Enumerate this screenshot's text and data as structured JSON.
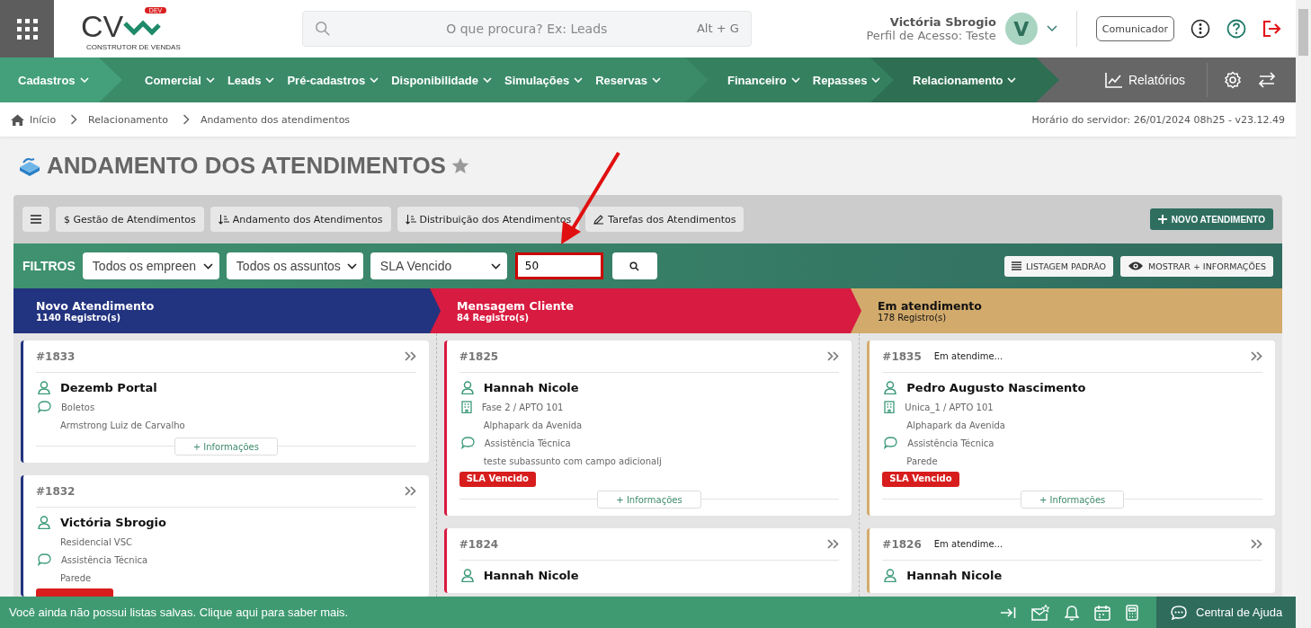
{
  "header": {
    "logo": {
      "mark": "CV",
      "tag": "DEV",
      "subtitle": "CONSTRUTOR DE VENDAS"
    },
    "search": {
      "placeholder": "O que procura? Ex: Leads",
      "shortcut": "Alt + G"
    },
    "user": {
      "name": "Victória Sbrogio",
      "profile": "Perfil de Acesso: Teste",
      "initial": "V"
    },
    "communicator": "Comunicador"
  },
  "nav": {
    "groups": [
      {
        "items": [
          "Cadastros"
        ]
      },
      {
        "items": [
          "Comercial",
          "Leads",
          "Pré-cadastros",
          "Disponibilidade",
          "Simulações",
          "Reservas"
        ]
      },
      {
        "items": [
          "Financeiro",
          "Repasses"
        ]
      },
      {
        "items": [
          "Relacionamento"
        ]
      }
    ],
    "reports": "Relatórios"
  },
  "breadcrumb": {
    "items": [
      "Início",
      "Relacionamento",
      "Andamento dos atendimentos"
    ],
    "server_time": "Horário do servidor: 26/01/2024 08h25 - v23.12.49"
  },
  "page_title": "ANDAMENTO DOS ATENDIMENTOS",
  "toolbar": {
    "tabs": [
      {
        "kind": "plain",
        "label": "$ Gestão de Atendimentos"
      },
      {
        "kind": "sort",
        "label": "Andamento dos Atendimentos"
      },
      {
        "kind": "sort",
        "label": "Distribuição dos Atendimentos"
      },
      {
        "kind": "edit",
        "label": "Tarefas dos Atendimentos"
      }
    ],
    "new_button": "NOVO ATENDIMENTO"
  },
  "filters": {
    "label": "FILTROS",
    "selects": [
      "Todos os empreen",
      "Todos os assuntos",
      "SLA Vencido"
    ],
    "code": {
      "value": "50",
      "highlighted": true
    },
    "list_button": "LISTAGEM PADRÃO",
    "more_button": "MOSTRAR + INFORMAÇÕES"
  },
  "columns": [
    {
      "title": "Novo Atendimento",
      "count": "1140 Registro(s)",
      "color": "#22337f",
      "cards": [
        {
          "id": "#1833",
          "lines": [
            {
              "kind": "person",
              "text": "Dezemb Portal"
            },
            {
              "kind": "chat",
              "text": "Boletos"
            },
            {
              "kind": "plain",
              "text": "Armstrong Luiz de Carvalho"
            }
          ],
          "more": "+ Informações"
        },
        {
          "id": "#1832",
          "lines": [
            {
              "kind": "person",
              "text": "Victória Sbrogio"
            },
            {
              "kind": "plain",
              "text": "Residencial VSC"
            },
            {
              "kind": "chat",
              "text": "Assistência Técnica"
            },
            {
              "kind": "plain",
              "text": "Parede"
            }
          ],
          "badge_covered": true
        }
      ]
    },
    {
      "title": "Mensagem Cliente",
      "count": "84 Registro(s)",
      "color": "#d81b40",
      "cards": [
        {
          "id": "#1825",
          "lines": [
            {
              "kind": "person",
              "text": "Hannah Nicole"
            },
            {
              "kind": "building",
              "text": "Fase 2 / APTO 101"
            },
            {
              "kind": "plain",
              "text": "Alphapark da Avenida"
            },
            {
              "kind": "chat",
              "text": "Assistência Técnica"
            },
            {
              "kind": "plain",
              "text": "teste subassunto com campo adicionalj"
            }
          ],
          "badge": "SLA Vencido",
          "more": "+ Informações"
        },
        {
          "id": "#1824",
          "lines": [
            {
              "kind": "person",
              "text": "Hannah Nicole"
            }
          ]
        }
      ]
    },
    {
      "title": "Em atendimento",
      "count": "178 Registro(s)",
      "color": "#d2ab6c",
      "cards": [
        {
          "id": "#1835",
          "status": "Em atendime...",
          "lines": [
            {
              "kind": "person",
              "text": "Pedro Augusto Nascimento"
            },
            {
              "kind": "building",
              "text": "Unica_1 / APTO 101"
            },
            {
              "kind": "plain",
              "text": "Alphapark da Avenida"
            },
            {
              "kind": "chat",
              "text": "Assistência Técnica"
            },
            {
              "kind": "plain",
              "text": "Parede"
            }
          ],
          "badge": "SLA Vencido",
          "more": "+ Informações"
        },
        {
          "id": "#1826",
          "status": "Em atendime...",
          "lines": [
            {
              "kind": "person",
              "text": "Hannah Nicole"
            }
          ]
        }
      ]
    }
  ],
  "footer": {
    "message": "Você ainda não possui listas salvas. Clique aqui para saber mais.",
    "help": "Central de Ajuda"
  },
  "annotation": {
    "kind": "arrow"
  }
}
